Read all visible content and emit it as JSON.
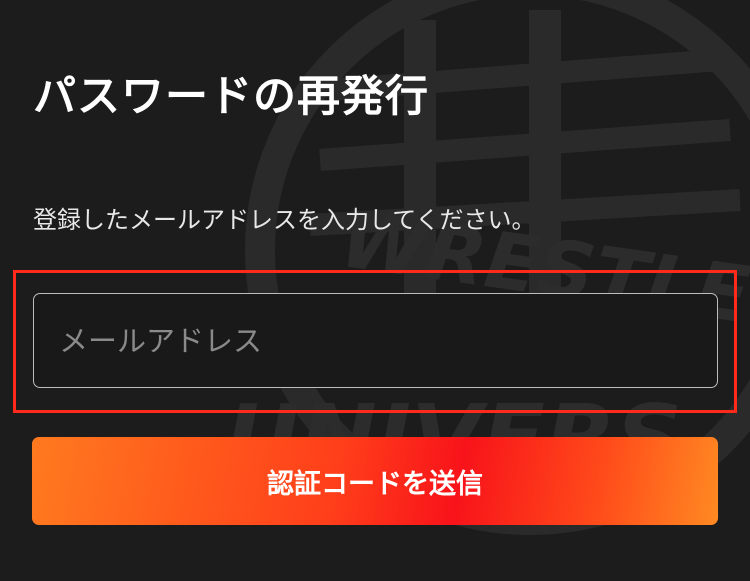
{
  "page": {
    "title": "パスワードの再発行",
    "instruction": "登録したメールアドレスを入力してください。"
  },
  "form": {
    "email_placeholder": "メールアドレス",
    "email_value": "",
    "submit_label": "認証コードを送信"
  },
  "watermark": {
    "icon": "wrestle-universe-logo-icon",
    "text_top": "WRESTLE",
    "text_bottom": "UNIVERS"
  },
  "colors": {
    "background": "#1c1c1c",
    "highlight_border": "#ff2a1a",
    "button_gradient_start": "#ff7a1f",
    "button_gradient_mid": "#f8131a",
    "button_gradient_end": "#ff8a22"
  }
}
